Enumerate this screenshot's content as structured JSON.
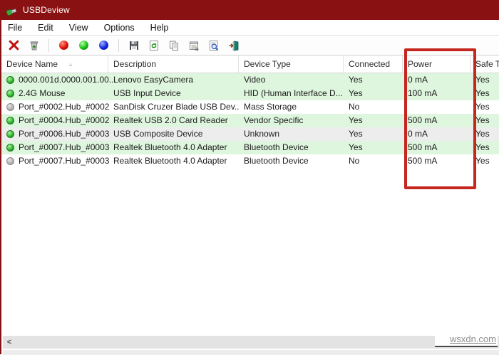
{
  "window": {
    "title": "USBDeview"
  },
  "menu": {
    "items": [
      "File",
      "Edit",
      "View",
      "Options",
      "Help"
    ]
  },
  "toolbar": {
    "icons": [
      "uninstall-delete",
      "disable-device",
      "red-ball",
      "green-ball",
      "blue-ball",
      "save-report",
      "refresh",
      "copy",
      "properties",
      "find",
      "exit"
    ]
  },
  "table": {
    "columns": [
      "Device Name",
      "Description",
      "Device Type",
      "Connected",
      "Power",
      "Safe Te"
    ],
    "sorted_column": "Device Name",
    "rows": [
      {
        "device_name": "0000.001d.0000.001.00...",
        "description": "Lenovo EasyCamera",
        "device_type": "Video",
        "connected": "Yes",
        "power": "0 mA",
        "safe_to_unplug": "Yes",
        "status": "connected"
      },
      {
        "device_name": "2.4G Mouse",
        "description": "USB Input Device",
        "device_type": "HID (Human Interface D...",
        "connected": "Yes",
        "power": "100 mA",
        "safe_to_unplug": "Yes",
        "status": "connected"
      },
      {
        "device_name": "Port_#0002.Hub_#0002",
        "description": "SanDisk Cruzer Blade USB Dev...",
        "device_type": "Mass Storage",
        "connected": "No",
        "power": "",
        "safe_to_unplug": "Yes",
        "status": "disconnected"
      },
      {
        "device_name": "Port_#0004.Hub_#0002",
        "description": "Realtek USB 2.0 Card Reader",
        "device_type": "Vendor Specific",
        "connected": "Yes",
        "power": "500 mA",
        "safe_to_unplug": "Yes",
        "status": "connected"
      },
      {
        "device_name": "Port_#0006.Hub_#0003",
        "description": "USB Composite Device",
        "device_type": "Unknown",
        "connected": "Yes",
        "power": "0 mA",
        "safe_to_unplug": "Yes",
        "status": "connected"
      },
      {
        "device_name": "Port_#0007.Hub_#0003",
        "description": "Realtek Bluetooth 4.0 Adapter",
        "device_type": "Bluetooth Device",
        "connected": "Yes",
        "power": "500 mA",
        "safe_to_unplug": "Yes",
        "status": "connected"
      },
      {
        "device_name": "Port_#0007.Hub_#0003",
        "description": "Realtek Bluetooth 4.0 Adapter",
        "device_type": "Bluetooth Device",
        "connected": "No",
        "power": "500 mA",
        "safe_to_unplug": "Yes",
        "status": "disconnected"
      }
    ]
  },
  "annotation": {
    "type": "highlight-rectangle",
    "target": "Power column",
    "color": "#c5271f"
  },
  "watermark": {
    "text": "wsxdn.com"
  },
  "scrollbar": {
    "left_arrow": "<"
  },
  "sort_glyph": "▵"
}
